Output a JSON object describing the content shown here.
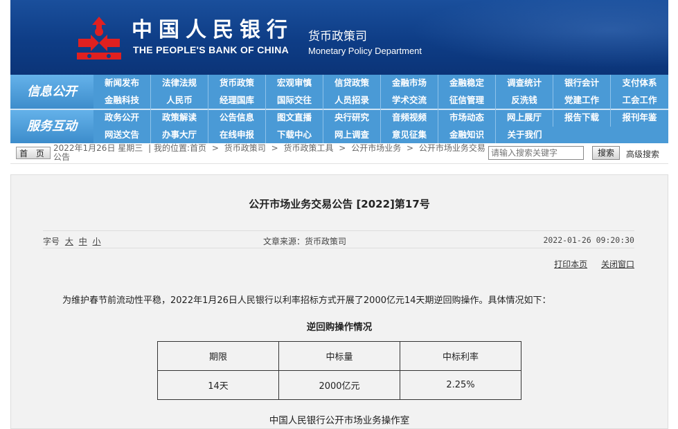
{
  "header": {
    "bank_name_cn": "中国人民银行",
    "bank_name_en": "THE PEOPLE'S BANK OF CHINA",
    "dept_cn": "货币政策司",
    "dept_en": "Monetary Policy Department",
    "logo_icon": "pboc-logo-icon",
    "bg_color": "#0e3d86"
  },
  "nav": {
    "section1": "信息公开",
    "section2": "服务互动",
    "row1": [
      "新闻发布",
      "法律法规",
      "货币政策",
      "宏观审慎",
      "信贷政策",
      "金融市场",
      "金融稳定",
      "调查统计",
      "银行会计",
      "支付体系"
    ],
    "row2": [
      "金融科技",
      "人民币",
      "经理国库",
      "国际交往",
      "人员招录",
      "学术交流",
      "征信管理",
      "反洗钱",
      "党建工作",
      "工会工作"
    ],
    "row3": [
      "政务公开",
      "政策解读",
      "公告信息",
      "图文直播",
      "央行研究",
      "音频视频",
      "市场动态",
      "网上展厅",
      "报告下载",
      "报刊年鉴"
    ],
    "row4": [
      "网送文告",
      "办事大厅",
      "在线申报",
      "下载中心",
      "网上调查",
      "意见征集",
      "金融知识",
      "关于我们"
    ],
    "accent": "#4a9ad6"
  },
  "breadcrumb": {
    "home_button": "首 页",
    "date_text": "2022年1月26日 星期三",
    "location_prefix": "| 我的位置:首页",
    "items": [
      "货币政策司",
      "货币政策工具",
      "公开市场业务",
      "公开市场业务交易公告"
    ],
    "search_placeholder": "请输入搜索关键字",
    "search_button": "搜索",
    "advanced_search": "高级搜索"
  },
  "article": {
    "title": "公开市场业务交易公告 [2022]第17号",
    "font_size_label": "字号",
    "font_sizes": [
      "大",
      "中",
      "小"
    ],
    "source": "文章来源：货币政策司",
    "datetime": "2022-01-26 09:20:30",
    "print_link": "打印本页",
    "close_link": "关闭窗口",
    "intro": "为维护春节前流动性平稳，2022年1月26日人民银行以利率招标方式开展了2000亿元14天期逆回购操作。具体情况如下：",
    "table_title": "逆回购操作情况",
    "table": {
      "headers": [
        "期限",
        "中标量",
        "中标利率"
      ],
      "rows": [
        [
          "14天",
          "2000亿元",
          "2.25%"
        ]
      ]
    },
    "signature": "中国人民银行公开市场业务操作室"
  }
}
